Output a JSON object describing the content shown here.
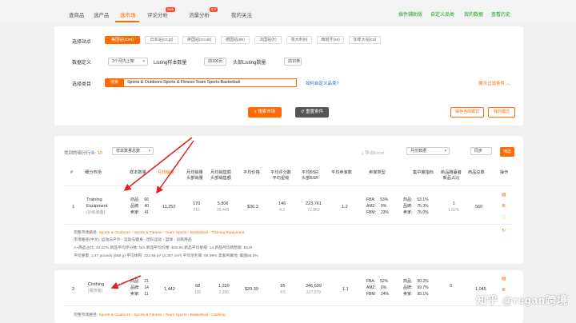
{
  "nav": {
    "tabs": [
      "查商品",
      "选产品",
      "选市场",
      "评论分析",
      "流量分析",
      "我的关注"
    ],
    "badges": [
      "new",
      "2.0"
    ],
    "right_links": [
      "插件辅助版",
      "自定义品类",
      "我的数据",
      "查看历史"
    ]
  },
  "filters": {
    "site_label": "选择站点",
    "sites": [
      "美国站(com)",
      "日本站(co.jp)",
      "英国站(co.uk)",
      "德国站(de)",
      "法国站(fr)",
      "意大利(it)",
      "西班牙(es)",
      "加拿大站(ca)"
    ],
    "range_label": "数据定义",
    "range_value": "3个月内上架",
    "listing_label": "Listing样本数量",
    "listing_value": "前100页",
    "head_label": "头部Listing数量",
    "head_value": "前10条",
    "cat_label": "选择类目",
    "search_tag": "搜索",
    "search_value": "Sports & Outdoors:Sports & Fitness:Team Sports:Basketball",
    "custom_link": "如何自定义品类?",
    "expand_link": "展示过滤条件"
  },
  "actions": {
    "market_btn": "搜索市场",
    "reset_btn": "重置条件",
    "save_btn": "保存当前模式",
    "my_btn": "我的模式"
  },
  "results": {
    "count_label": "找到的细分行业:",
    "count": "10",
    "sort_value": "样本数量总数",
    "export": "导出Excel",
    "month_value": "月份数据",
    "type_value": "同步",
    "filter_btn": "筛选"
  },
  "table": {
    "headers": [
      "#",
      "细分市场",
      "样本数量",
      "月均销量",
      "月均销量\n头部销量",
      "月均销售额\n头部销售额",
      "平均价格",
      "平均评分数\n平均星级",
      "平均BSR\n头部BSR",
      "平均卖家数",
      "卖家类型",
      "集中度指标",
      "新品跑赢者\n新品占比",
      "商品总数",
      "操作"
    ],
    "rows": [
      {
        "idx": "1",
        "name": "Training Equipment",
        "name_cn": "(训练装备)",
        "stats": [
          [
            "商品:",
            "66"
          ],
          [
            "品牌:",
            "40"
          ],
          [
            "卖家:",
            "41"
          ]
        ],
        "sales": "11,252",
        "head": "170",
        "head_sub": "710",
        "revenue": "5,806",
        "revenue_sub": "26,445",
        "price": "$36.3",
        "rating": "146",
        "rating_sub": "4.3",
        "bsr": "223,761",
        "bsr_sub": "72,963",
        "sellers": "1.2",
        "types": [
          [
            "FBA:",
            "53%"
          ],
          [
            "AMZ:",
            "9%"
          ],
          [
            "FBM:",
            "23%"
          ]
        ],
        "conc": [
          [
            "商品:",
            "63.1%"
          ],
          [
            "品牌:",
            "75.3%"
          ],
          [
            "卖家:",
            "75.0%"
          ]
        ],
        "newp": "1",
        "newp_sub": "1.52%",
        "total": "560",
        "detail": {
          "path_label": "完整市场路径:",
          "path": "Sports & Outdoors › Sports & Fitness › Team Sports › Basketball › Training Equipment",
          "cn_path": "市场路径(中文): 运动与户外 › 运动与健身 › 团队运动 › 篮球 › 训练用品",
          "line3": "A+商品占比: 42.42%    新品平均评分数: N/A    新品平均价格: $26.95    新品平均星级: 14    新品月均销售额: $410",
          "line4": "平均重量: 1.47 pounds (665 g)    平均体积: 222.66 in³ (3,287 cm³)    平均毛利率: 68.99%    卖家所属地: 美国56.3%"
        }
      },
      {
        "idx": "2",
        "name": "Clothing",
        "name_cn": "(服饰装)",
        "stats": [
          [
            "商品:",
            "21"
          ],
          [
            "品牌:",
            "14"
          ],
          [
            "卖家:",
            "11"
          ]
        ],
        "sales": "1,442",
        "head": "68",
        "head_sub": "130",
        "revenue": "1,229",
        "revenue_sub": "2,300",
        "price": "$20.39",
        "rating": "95",
        "rating_sub": "4.5",
        "bsr": "346,699",
        "bsr_sub": "327,079",
        "sellers": "1.1",
        "types": [
          [
            "FBA:",
            "52%"
          ],
          [
            "AMZ:",
            "0%"
          ],
          [
            "FBM:",
            "24%"
          ]
        ],
        "conc": [
          [
            "商品:",
            "90.2%"
          ],
          [
            "品牌:",
            "99.7%"
          ],
          [
            "卖家:",
            "95.1%"
          ]
        ],
        "newp": "0",
        "newp_sub": "",
        "total": "1,045",
        "detail": {
          "path_label": "完整市场路径:",
          "path": "Sports & Outdoors › Sports & Fitness › Team Sports › Basketball › Clothing"
        }
      }
    ]
  },
  "watermark": "知乎 @regan跨境"
}
